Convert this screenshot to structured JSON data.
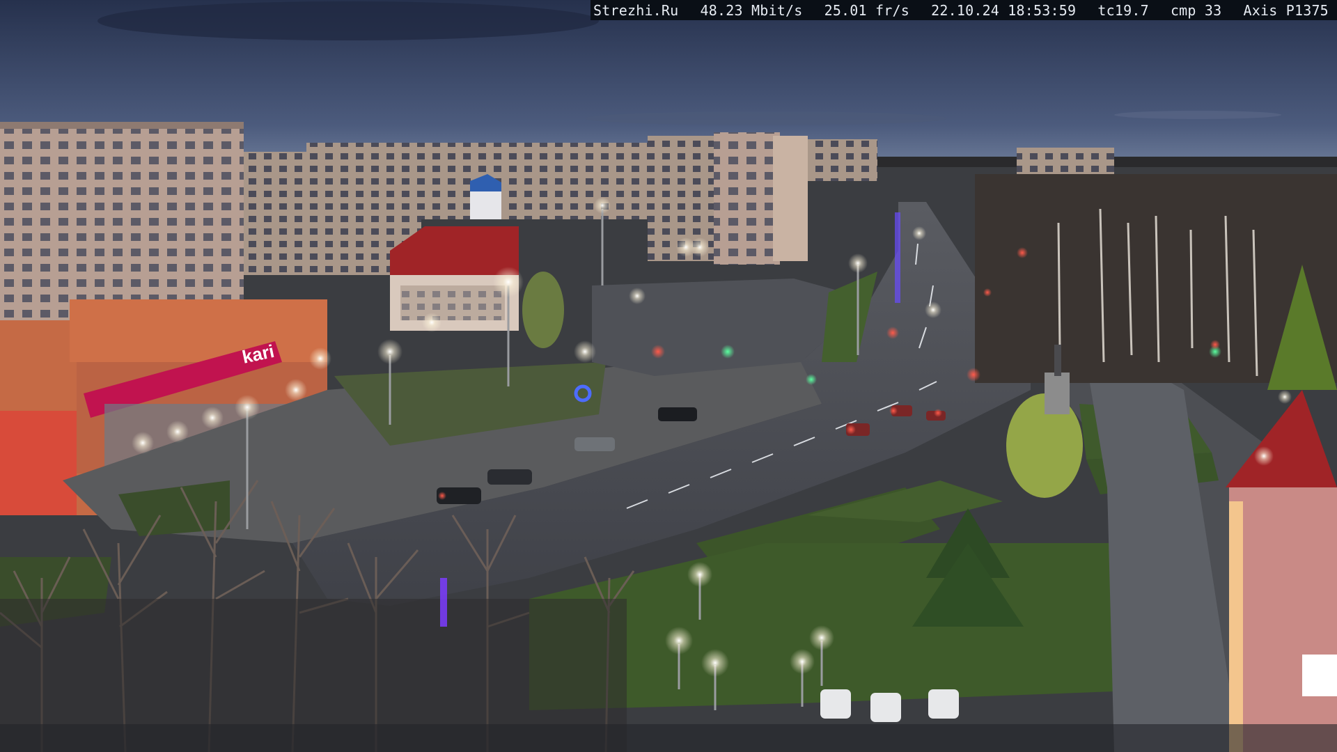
{
  "overlay": {
    "site": "Strezhi.Ru",
    "bitrate": "48.23 Mbit/s",
    "framerate": "25.01 fr/s",
    "datetime": "22.10.24 18:53:59",
    "tc": "tc19.7",
    "cmp": "cmp 33",
    "camera_model": "Axis P1375"
  },
  "storefront": {
    "sign_text": "kari"
  },
  "colors": {
    "sky_top": "#2a3553",
    "sky_horizon": "#5e6f8f",
    "road": "#4a4d55",
    "grass": "#3f5a2c",
    "brick_building": "#c3a798",
    "orange_building": "#d46a3e",
    "red_roof": "#a02427",
    "street_light": "#ffffff",
    "traffic_light_red": "#ff3b30",
    "traffic_light_green": "#36e07a",
    "sign_magenta": "#c1134f"
  }
}
